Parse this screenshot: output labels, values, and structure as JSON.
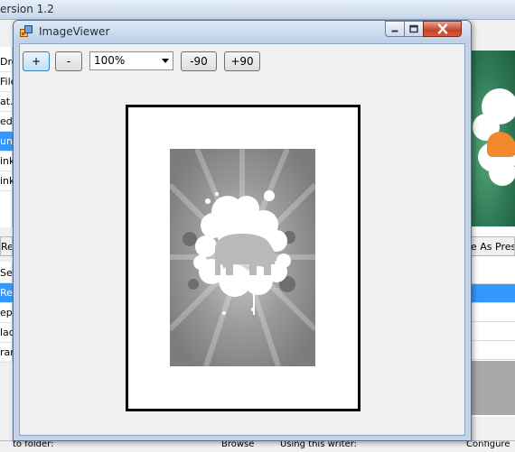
{
  "background_app": {
    "title": "ersion 1.2",
    "left_rows": [
      {
        "text": "Dro",
        "selected": false
      },
      {
        "text": "File",
        "selected": false
      },
      {
        "text": "at.",
        "selected": false
      },
      {
        "text": "ed",
        "selected": false
      },
      {
        "text": "un",
        "selected": true
      },
      {
        "text": "ink",
        "selected": false
      },
      {
        "text": "ink",
        "selected": false
      }
    ],
    "left_tab": "Re",
    "left_rows_2": [
      {
        "text": "Sel",
        "selected": false
      },
      {
        "text": "Res",
        "selected": true
      },
      {
        "text": "ep",
        "selected": false
      },
      {
        "text": "lad",
        "selected": false
      },
      {
        "text": "ran",
        "selected": false
      }
    ],
    "right_label": "e As Pres",
    "status_items": [
      "to folder:",
      "Browse",
      "Using this writer:",
      "Configure"
    ]
  },
  "window": {
    "title": "ImageViewer",
    "icon": "app-icon",
    "caption_buttons": {
      "minimize": "minimize-icon",
      "maximize": "maximize-icon",
      "close": "close-icon"
    }
  },
  "toolbar": {
    "zoom_in_label": "+",
    "zoom_out_label": "-",
    "zoom_value": "100%",
    "rotate_left_label": "-90",
    "rotate_right_label": "+90"
  },
  "image": {
    "subject": "elephant-silhouette",
    "colors": {
      "background": "#8c8c8c",
      "cloud": "#ffffff",
      "elephant": "#b9b9b9"
    }
  },
  "colors": {
    "selection": "#3399ff",
    "close_button": "#c7432a"
  }
}
